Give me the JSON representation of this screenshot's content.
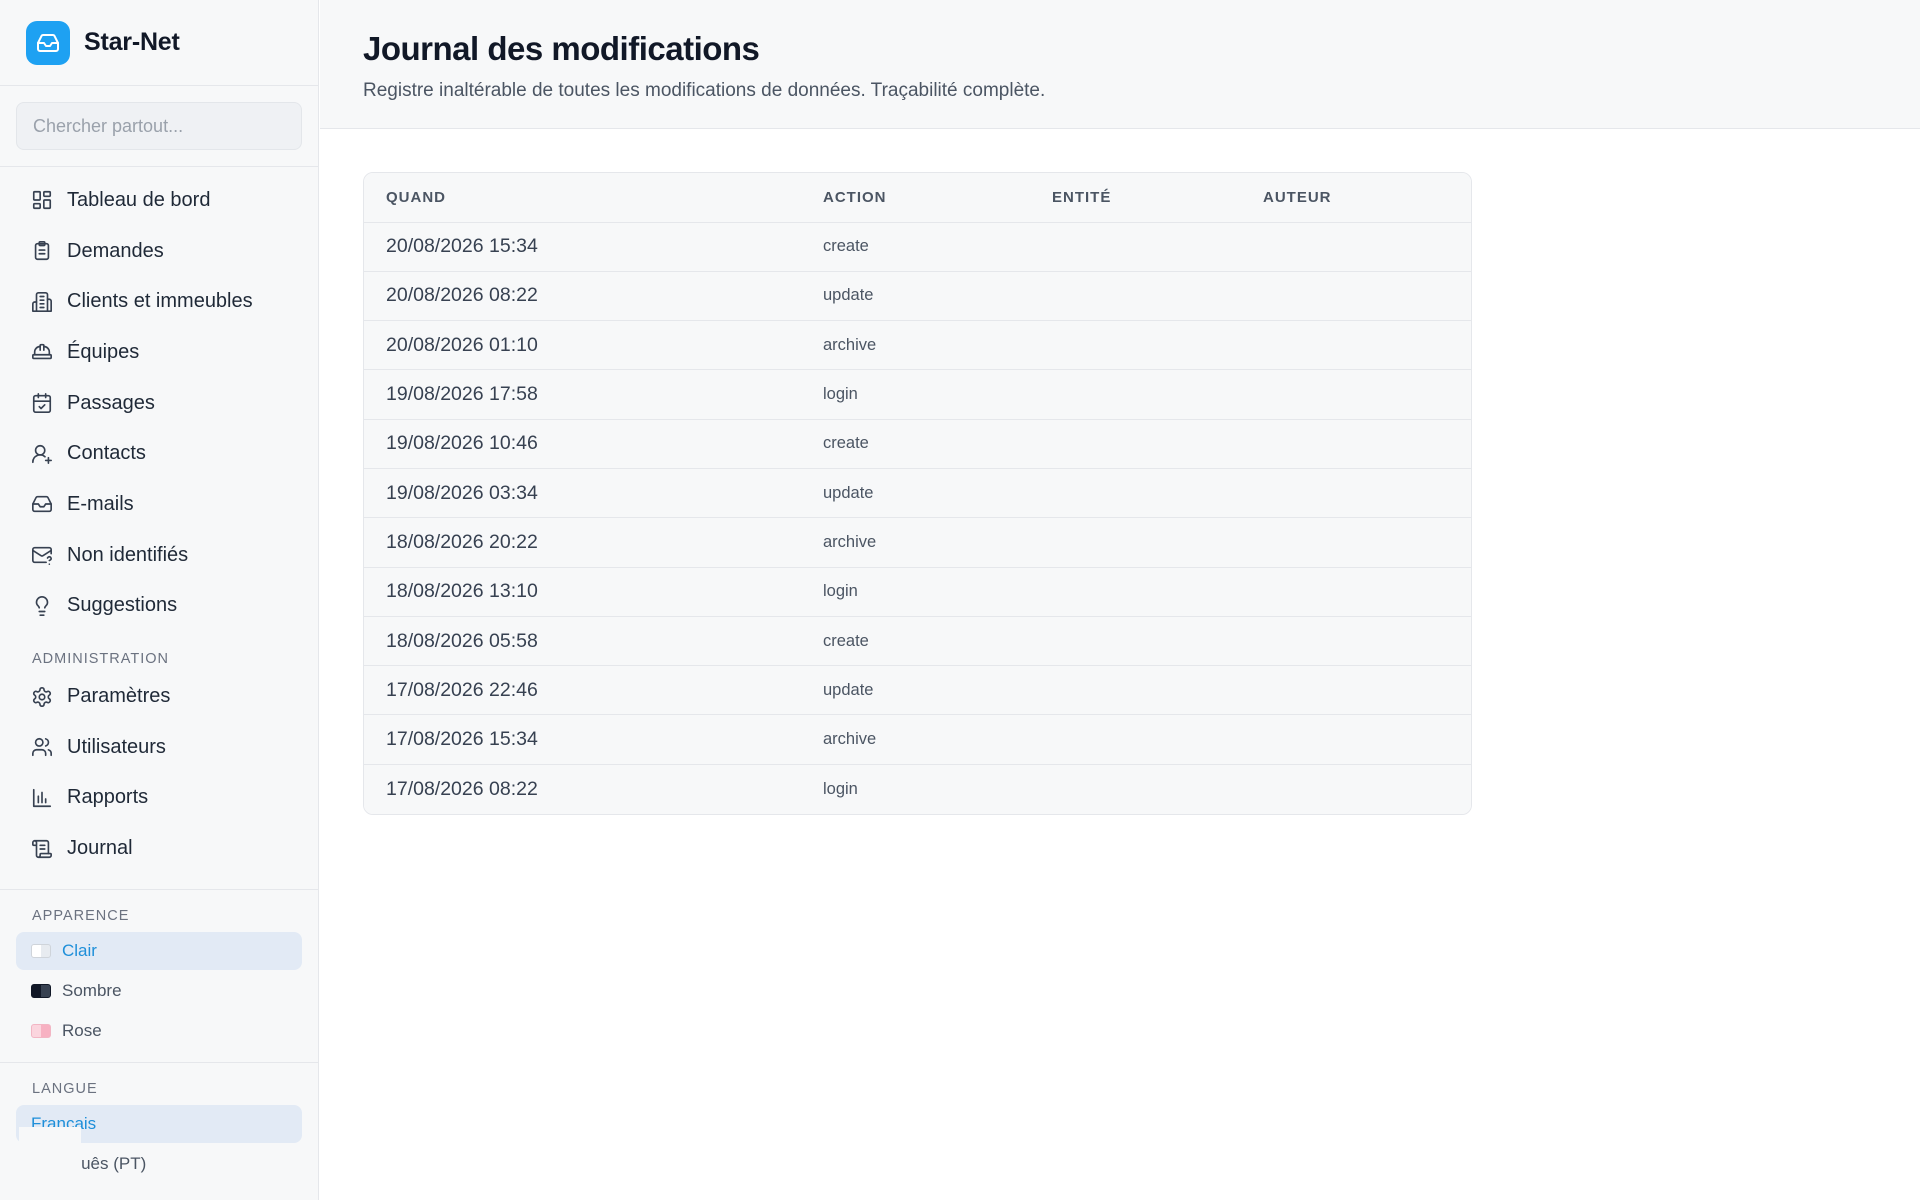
{
  "brand": {
    "name": "Star-Net"
  },
  "search": {
    "placeholder": "Chercher partout..."
  },
  "nav": [
    {
      "label": "Tableau de bord",
      "icon": "dashboard-icon"
    },
    {
      "label": "Demandes",
      "icon": "clipboard-icon"
    },
    {
      "label": "Clients et immeubles",
      "icon": "building-icon"
    },
    {
      "label": "Équipes",
      "icon": "hardhat-icon"
    },
    {
      "label": "Passages",
      "icon": "calendar-check-icon"
    },
    {
      "label": "Contacts",
      "icon": "contact-icon"
    },
    {
      "label": "E-mails",
      "icon": "inbox-icon"
    },
    {
      "label": "Non identifiés",
      "icon": "mail-question-icon"
    },
    {
      "label": "Suggestions",
      "icon": "lightbulb-icon"
    }
  ],
  "admin": {
    "label": "ADMINISTRATION",
    "items": [
      {
        "label": "Paramètres",
        "icon": "gear-icon"
      },
      {
        "label": "Utilisateurs",
        "icon": "users-icon"
      },
      {
        "label": "Rapports",
        "icon": "bar-chart-icon"
      },
      {
        "label": "Journal",
        "icon": "scroll-icon"
      }
    ]
  },
  "appearance": {
    "label": "APPARENCE",
    "options": [
      {
        "label": "Clair",
        "active": true
      },
      {
        "label": "Sombre",
        "active": false
      },
      {
        "label": "Rose",
        "active": false
      }
    ]
  },
  "language": {
    "label": "LANGUE",
    "options": [
      {
        "label": "Français",
        "active": true
      },
      {
        "label": "Português (PT)",
        "active": false
      }
    ]
  },
  "page": {
    "title": "Journal des modifications",
    "subtitle": "Registre inaltérable de toutes les modifications de données. Traçabilité complète."
  },
  "table": {
    "headers": [
      "QUAND",
      "ACTION",
      "ENTITÉ",
      "AUTEUR"
    ],
    "rows": [
      {
        "when": "20/08/2026 15:34",
        "action": "create"
      },
      {
        "when": "20/08/2026 08:22",
        "action": "update"
      },
      {
        "when": "20/08/2026 01:10",
        "action": "archive"
      },
      {
        "when": "19/08/2026 17:58",
        "action": "login"
      },
      {
        "when": "19/08/2026 10:46",
        "action": "create"
      },
      {
        "when": "19/08/2026 03:34",
        "action": "update"
      },
      {
        "when": "18/08/2026 20:22",
        "action": "archive"
      },
      {
        "when": "18/08/2026 13:10",
        "action": "login"
      },
      {
        "when": "18/08/2026 05:58",
        "action": "create"
      },
      {
        "when": "17/08/2026 22:46",
        "action": "update"
      },
      {
        "when": "17/08/2026 15:34",
        "action": "archive"
      },
      {
        "when": "17/08/2026 08:22",
        "action": "login"
      }
    ]
  },
  "colors": {
    "accent": "#1ea1f2",
    "active_bg": "#e2eaf5",
    "active_text": "#1e8fd9"
  }
}
